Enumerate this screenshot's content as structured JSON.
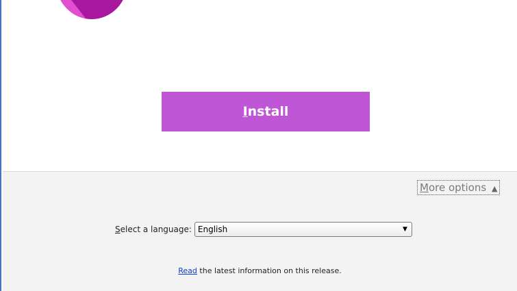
{
  "install_button": {
    "label": "Install"
  },
  "more_options": {
    "label": "More options",
    "chevron_icon": "chevron-up-icon"
  },
  "language": {
    "label": "Select a language:",
    "selected": "English",
    "dropdown_icon": "dropdown-arrow-icon"
  },
  "release_info": {
    "link_text": "Read",
    "text": " the latest information on this release."
  },
  "colors": {
    "accent": "#bf56d6",
    "logo": "#a7189e",
    "window_border": "#4a72c4",
    "footer_bg": "#f3f3f3",
    "link": "#0b3cd6"
  }
}
